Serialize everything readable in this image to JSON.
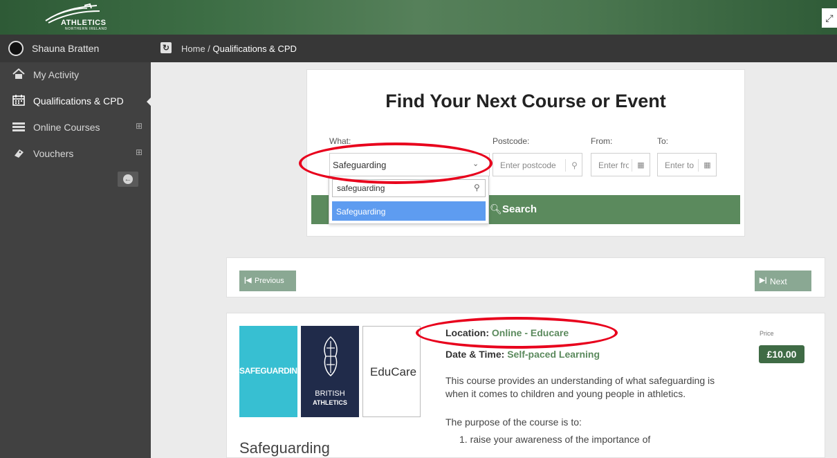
{
  "colors": {
    "accent_green": "#5b8a5d",
    "dark_green": "#3f6b45",
    "sidebar": "#414141",
    "annotation_red": "#e8001c"
  },
  "brand": {
    "name": "ATHLETICS",
    "sub": "NORTHERN IRELAND"
  },
  "sidebar": {
    "user_name": "Shauna Bratten",
    "items": [
      {
        "label": "My Activity",
        "icon": "home-icon"
      },
      {
        "label": "Qualifications & CPD",
        "icon": "calendar-icon"
      },
      {
        "label": "Online Courses",
        "icon": "list-icon",
        "expander": "⊞"
      },
      {
        "label": "Vouchers",
        "icon": "ticket-icon",
        "expander": "⊞"
      }
    ]
  },
  "breadcrumb": {
    "home": "Home /",
    "current": "Qualifications & CPD"
  },
  "search": {
    "title": "Find Your Next Course or Event",
    "what_label": "What:",
    "what_value": "Safeguarding",
    "postcode_label": "Postcode:",
    "postcode_placeholder": "Enter postcode",
    "from_label": "From:",
    "from_placeholder": "Enter from",
    "to_label": "To:",
    "to_placeholder": "Enter to",
    "button_label": "Search",
    "dropdown_query": "safeguarding",
    "dropdown_option": "Safeguarding"
  },
  "pager": {
    "prev": "Previous",
    "next": "Next"
  },
  "course": {
    "image_safeguarding": "SAFEGUARDING",
    "image_ba_line1": "BRITISH",
    "image_ba_line2": "ATHLETICS",
    "image_educare": "EduCare",
    "title": "Safeguarding",
    "location_label": "Location:",
    "location_value": "Online - Educare",
    "datetime_label": "Date & Time:",
    "datetime_value": "Self-paced Learning",
    "description": "This course provides an understanding of what safeguarding is when it comes to children and young people in athletics.",
    "purpose": "The purpose of the course is to:",
    "purpose_item_1": "1. raise your awareness of the importance of",
    "price_label": "Price",
    "price": "£10.00"
  }
}
